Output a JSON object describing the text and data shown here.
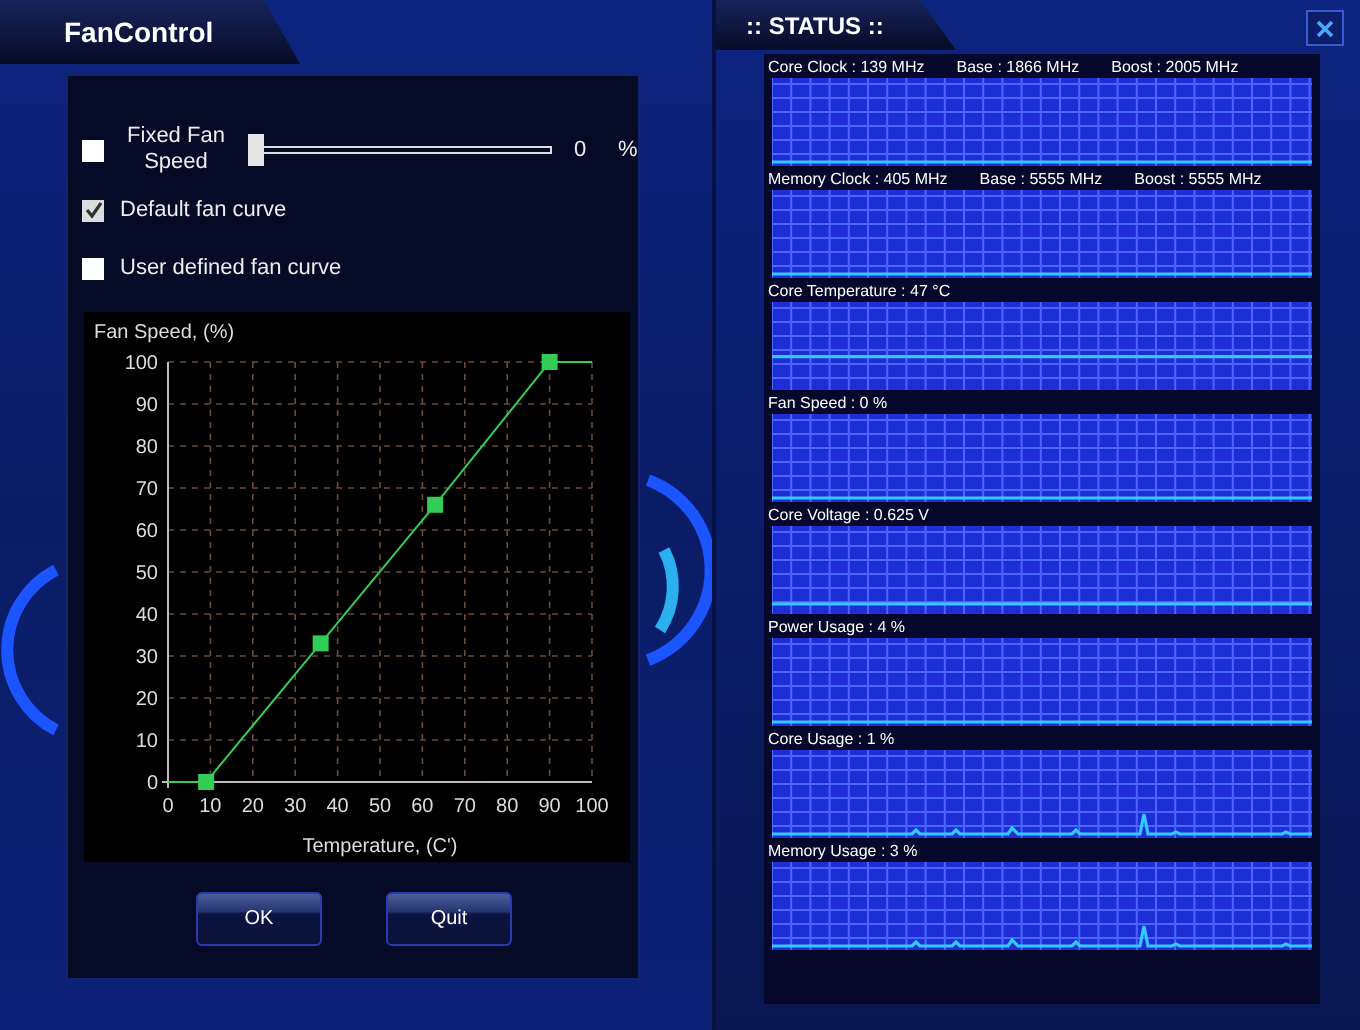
{
  "fan_control": {
    "title": "FanControl",
    "options": [
      {
        "kind": "slider",
        "label": "Fixed Fan Speed",
        "checked": false,
        "level": 0,
        "value": "0",
        "unit": "%"
      },
      {
        "kind": "plain",
        "label": "Default fan curve",
        "checked": true
      },
      {
        "kind": "plain",
        "label": "User defined fan curve",
        "checked": false
      }
    ],
    "chart_data": {
      "type": "line",
      "title": "Fan Speed, (%)",
      "xlabel": "Temperature, (C')",
      "x": [
        0,
        9,
        36,
        63,
        90,
        100
      ],
      "series": [
        {
          "color": "#33cc55",
          "values": [
            0,
            0,
            33,
            66,
            100,
            100
          ]
        }
      ],
      "grid": true,
      "xlim": [
        0,
        100
      ],
      "ylim": [
        0,
        100
      ],
      "xticks": [
        0,
        10,
        20,
        30,
        40,
        50,
        60,
        70,
        80,
        90,
        100
      ],
      "yticks": [
        0,
        10,
        20,
        30,
        40,
        50,
        60,
        70,
        80,
        90,
        100
      ]
    },
    "buttons": [
      {
        "label": "OK"
      },
      {
        "label": "Quit"
      }
    ]
  },
  "status": {
    "title": ":: STATUS ::",
    "graphs": [
      {
        "texts": [
          "Core Clock : 139 MHz",
          "Base : 1866 MHz",
          "Boost : 2005 MHz"
        ],
        "kind": "bottom"
      },
      {
        "texts": [
          "Memory Clock : 405 MHz",
          "Base : 5555 MHz",
          "Boost : 5555 MHz"
        ],
        "kind": "bottom"
      },
      {
        "texts": [
          "Core Temperature : 47 °C"
        ],
        "kind": "middle"
      },
      {
        "texts": [
          "Fan Speed : 0 %"
        ],
        "kind": "bottom"
      },
      {
        "texts": [
          "Core Voltage : 0.625 V"
        ],
        "kind": "low"
      },
      {
        "texts": [
          "Power Usage : 4 %"
        ],
        "kind": "bottom"
      },
      {
        "texts": [
          "Core Usage : 1 %"
        ],
        "kind": "spikes"
      },
      {
        "texts": [
          "Memory Usage : 3 %"
        ],
        "kind": "spikes"
      }
    ]
  }
}
